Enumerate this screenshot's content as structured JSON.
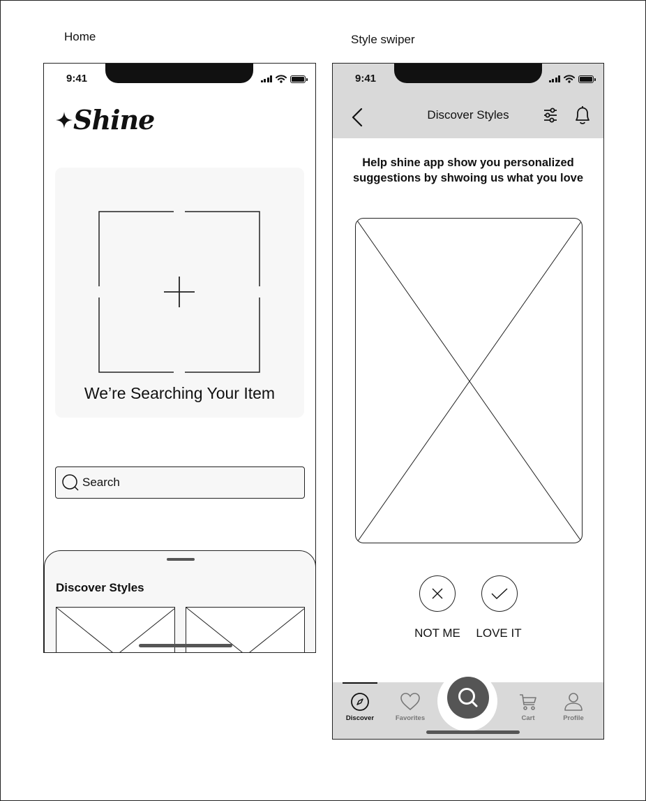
{
  "frames": {
    "home_label": "Home",
    "swiper_label": "Style swiper"
  },
  "home": {
    "status_time": "9:41",
    "logo_text": "Shine",
    "scan_title": "We’re Searching Your Item",
    "search_placeholder": "Search",
    "sheet_title": "Discover Styles"
  },
  "swiper": {
    "status_time": "9:41",
    "nav_title": "Discover Styles",
    "help_text": "Help shine app show you personalized suggestions by shwoing us what you love",
    "reject_label": "NOT ME",
    "accept_label": "LOVE IT",
    "tabs": [
      {
        "label": "Discover",
        "icon": "compass-icon",
        "active": true
      },
      {
        "label": "Favorites",
        "icon": "heart-icon",
        "active": false
      },
      {
        "label": "Cart",
        "icon": "cart-icon",
        "active": false
      },
      {
        "label": "Profile",
        "icon": "profile-icon",
        "active": false
      }
    ],
    "center_action_icon": "search-icon"
  },
  "colors": {
    "navbar_bg": "#d9d9d9",
    "panel_bg": "#f7f7f7",
    "fab_bg": "#555555",
    "ink": "#111111"
  }
}
